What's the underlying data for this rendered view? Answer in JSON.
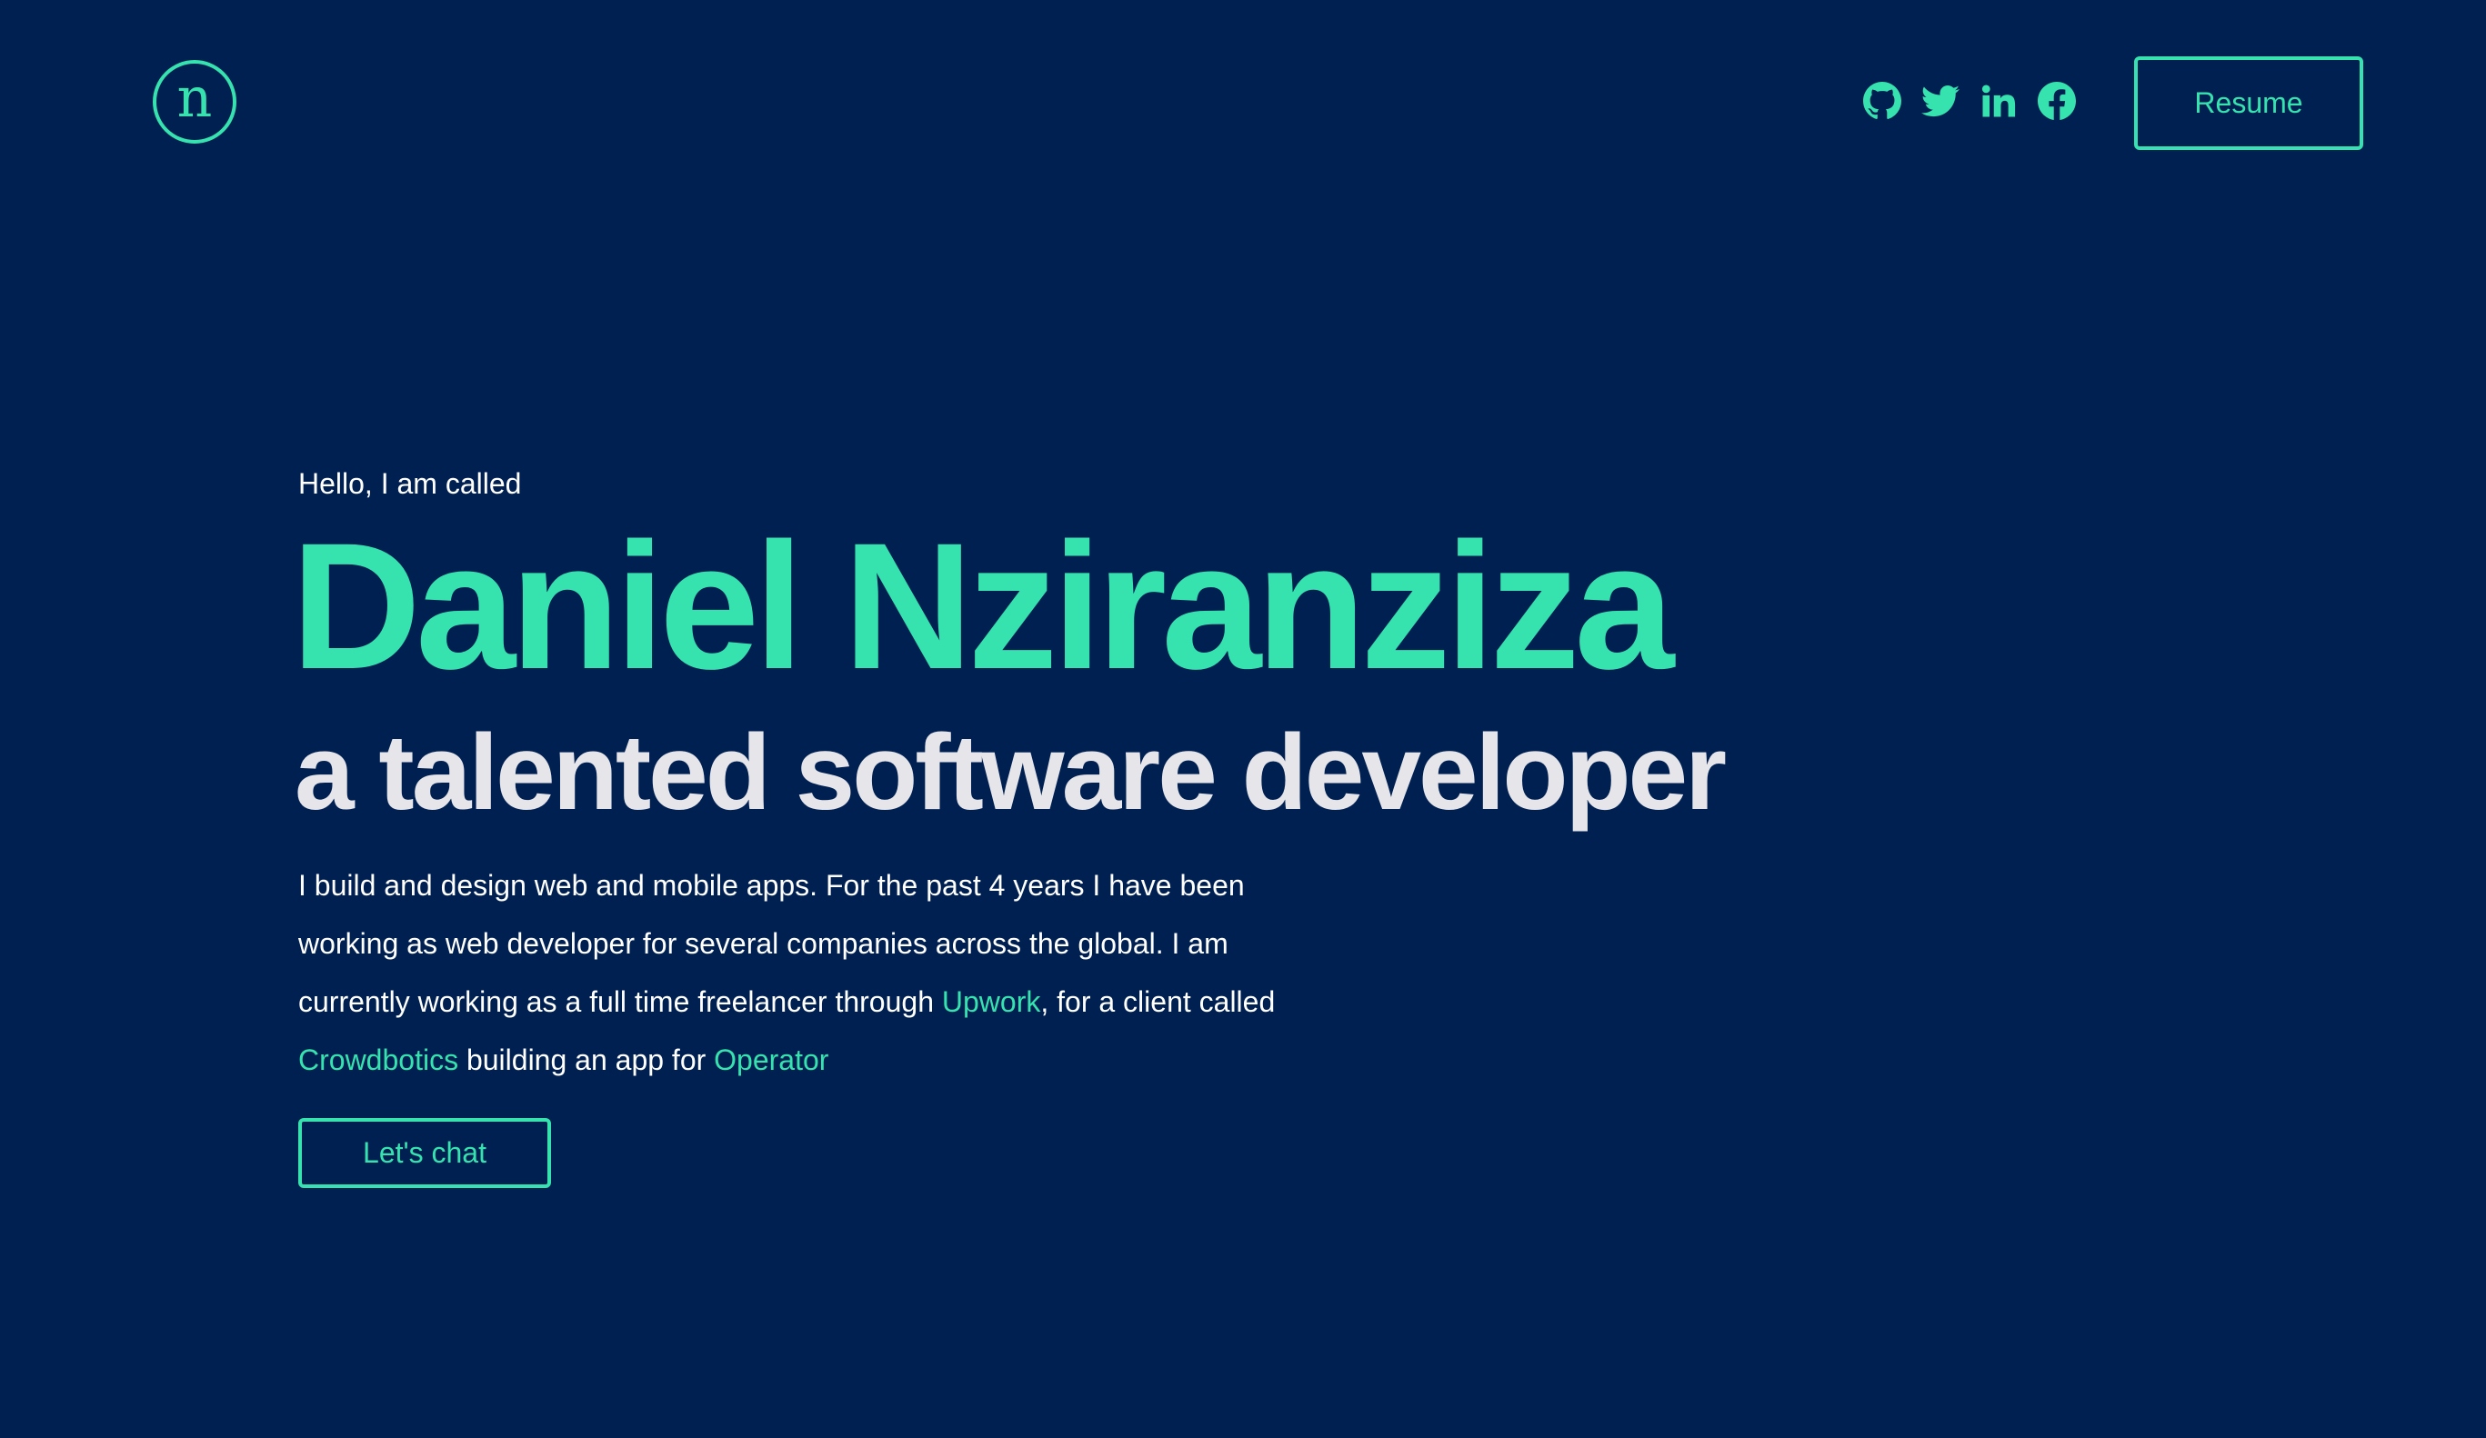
{
  "header": {
    "logo_letter": "n",
    "social_icons": [
      "github-icon",
      "twitter-icon",
      "linkedin-icon",
      "facebook-icon"
    ],
    "resume_label": "Resume"
  },
  "hero": {
    "greeting": "Hello, I am called",
    "name": "Daniel Nziranziza",
    "tagline": "a talented software developer",
    "bio": {
      "part1": "I build and design web and mobile apps. For the past 4 years I have been working as web developer for several companies across the global. I am currently working as a full time freelancer through ",
      "link1": "Upwork",
      "part2": ", for a client called ",
      "link2": "Crowdbotics",
      "part3": " building an app for ",
      "link3": "Operator"
    },
    "cta_label": "Let's chat"
  },
  "colors": {
    "background": "#012052",
    "accent": "#36e2ae",
    "heading_light": "#e6e6ea",
    "text": "#ffffff"
  }
}
